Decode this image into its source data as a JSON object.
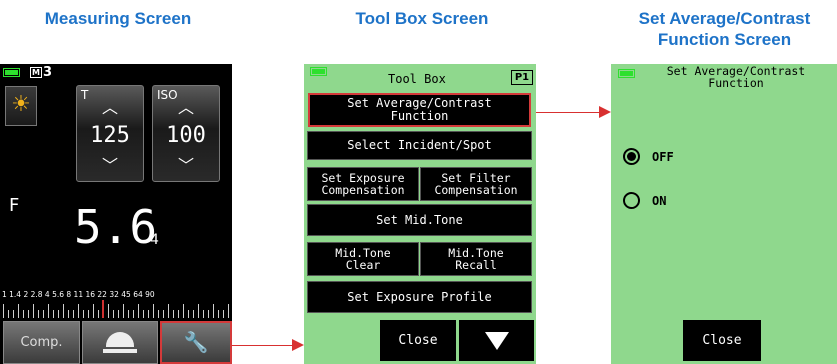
{
  "headings": {
    "measuring": "Measuring Screen",
    "toolbox": "Tool Box Screen",
    "setavg_line1": "Set Average/Contrast",
    "setavg_line2": "Function Screen"
  },
  "measuring": {
    "memory_box": "M",
    "memory_num": "3",
    "t_label": "T",
    "t_value": "125",
    "iso_label": "ISO",
    "iso_value": "100",
    "f_label": "F",
    "f_value": "5.6",
    "f_tenths": "4",
    "scale_labels": "1  1.4  2  2.8  4  5.6  8  11  16  22  32  45  64  90",
    "comp_label": "Comp.",
    "icons": [
      "battery-icon",
      "sun-icon",
      "chevron-up-icon",
      "chevron-down-icon",
      "dome-icon",
      "wrench-icon"
    ]
  },
  "toolbox": {
    "title": "Tool Box",
    "page": "P1",
    "buttons": {
      "set_average": [
        "Set Average/Contrast",
        "Function"
      ],
      "select_incident": "Select Incident/Spot",
      "exposure_comp": [
        "Set Exposure",
        "Compensation"
      ],
      "filter_comp": [
        "Set Filter",
        "Compensation"
      ],
      "mid_tone": "Set Mid.Tone",
      "mid_clear": [
        "Mid.Tone",
        "Clear"
      ],
      "mid_recall": [
        "Mid.Tone",
        "Recall"
      ],
      "exposure_profile": "Set Exposure Profile",
      "close": "Close",
      "next_icon": "triangle-down-icon"
    }
  },
  "setavg": {
    "title_line1": "Set Average/Contrast",
    "title_line2": "Function",
    "options": [
      {
        "label": "OFF",
        "selected": true
      },
      {
        "label": "ON",
        "selected": false
      }
    ],
    "close": "Close"
  },
  "colors": {
    "heading": "#1e73c8",
    "screen_green": "#8fd88d",
    "highlight_red": "#d43a3a",
    "battery_green": "#2ee02e"
  }
}
